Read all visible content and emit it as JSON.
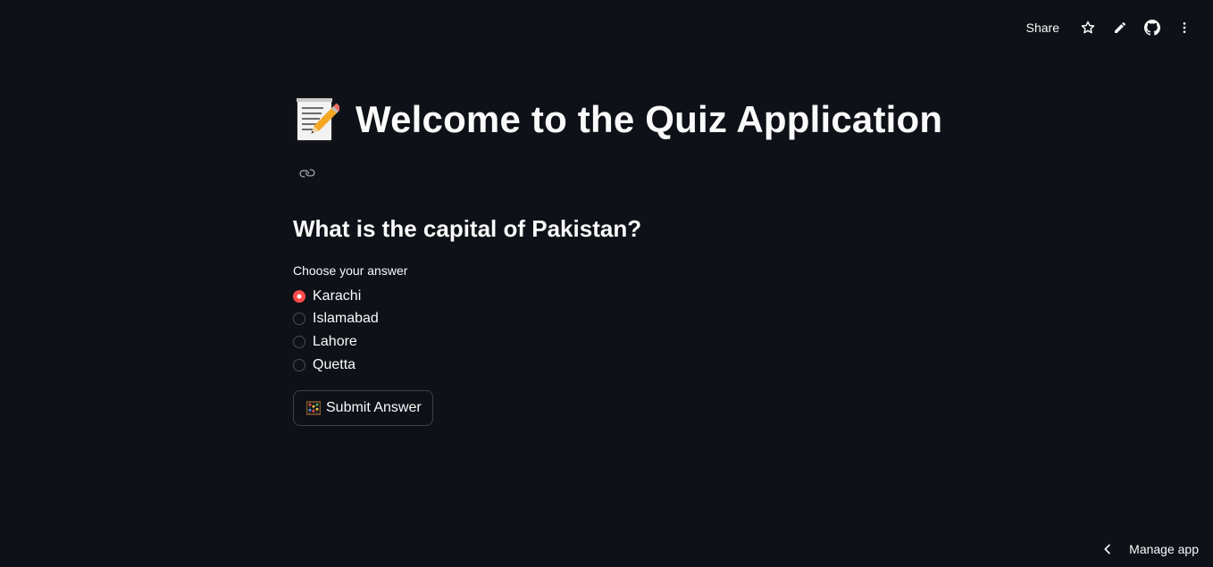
{
  "toolbar": {
    "share_label": "Share",
    "icons": [
      "star-icon",
      "pencil-icon",
      "github-icon",
      "more-vertical-icon"
    ]
  },
  "header": {
    "title": "Welcome to the Quiz Application",
    "title_icon": "memo-emoji-icon",
    "anchor_icon": "link-icon"
  },
  "quiz": {
    "question": "What is the capital of Pakistan?",
    "radio_label": "Choose your answer",
    "options": [
      "Karachi",
      "Islamabad",
      "Lahore",
      "Quetta"
    ],
    "selected_option": "Karachi",
    "submit_label": "Submit Answer",
    "submit_icon": "abacus-emoji-icon"
  },
  "footer": {
    "manage_label": "Manage app",
    "manage_icon": "chevron-left-icon"
  },
  "colors": {
    "background": "#0e1117",
    "text": "#fafafa",
    "accent": "#ff4b4b",
    "border": "#3d4049"
  }
}
